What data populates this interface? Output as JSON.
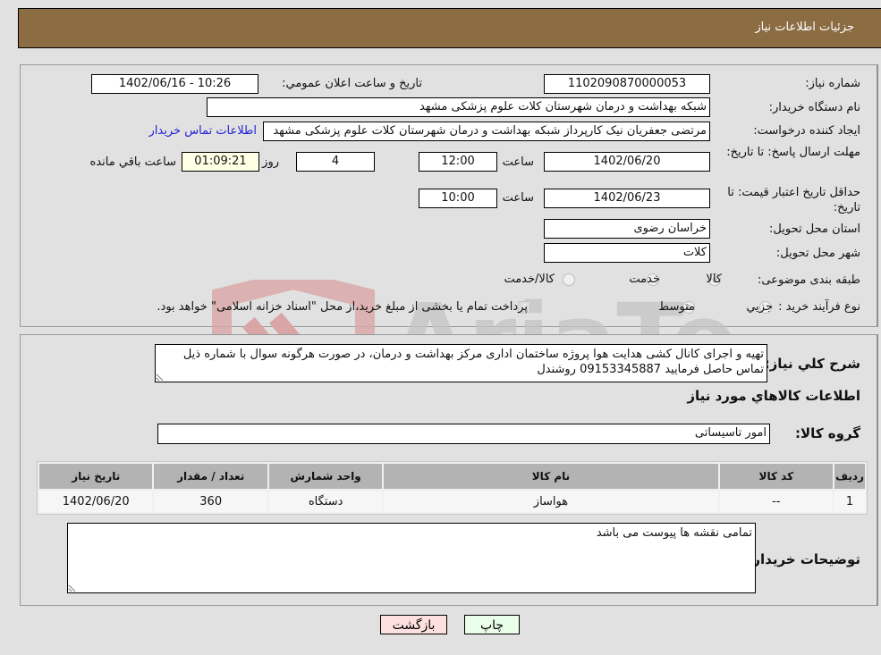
{
  "header": {
    "title": "جزئیات اطلاعات نیاز"
  },
  "form": {
    "need_number": {
      "label": "شماره نیاز:",
      "value": "1102090870000053"
    },
    "announce_datetime": {
      "label": "تاریخ و ساعت اعلان عمومي:",
      "value": "1402/06/16 - 10:26"
    },
    "buyer_org": {
      "label": "نام دستگاه خريدار:",
      "value": "شبکه بهداشت و درمان شهرستان کلات   علوم پزشکی مشهد"
    },
    "requester": {
      "label": "ایجاد کننده درخواست:",
      "value": "مرتضی جعفریان نیک کارپرداز شبکه بهداشت و درمان شهرستان کلات   علوم پزشکی مشهد",
      "contact_link": "اطلاعات تماس خريدار"
    },
    "response_deadline": {
      "label": "مهلت ارسال پاسخ: تا تاریخ:",
      "date": "1402/06/20",
      "time_label": "ساعت",
      "time": "12:00",
      "days": "4",
      "days_label": "روز و",
      "remaining": "01:09:21",
      "remaining_label": "ساعت باقي مانده"
    },
    "price_validity": {
      "label": "حداقل تاريخ اعتبار قيمت: تا تاریخ:",
      "date": "1402/06/23",
      "time_label": "ساعت",
      "time": "10:00"
    },
    "province": {
      "label": "استان محل تحویل:",
      "value": "خراسان رضوی"
    },
    "city": {
      "label": "شهر محل تحویل:",
      "value": "کلات"
    },
    "category": {
      "label": "طبقه بندی موضوعی:",
      "options": [
        "کالا",
        "خدمت",
        "کالا/خدمت"
      ],
      "selected": "کالا"
    },
    "process": {
      "label": "نوع فرآیند خرید :",
      "options": [
        "جزيي",
        "متوسط"
      ],
      "selected": "متوسط",
      "treasury_note": "پرداخت تمام یا بخشی از مبلغ خرید،از محل \"اسناد خزانه اسلامی\" خواهد بود.",
      "treasury_checked": true
    }
  },
  "details": {
    "description_label": "شرح کلي نياز:",
    "description": "تهیه و اجرای کانال کشی هدایت هوا پروژه ساختمان اداری مرکز بهداشت و درمان، در صورت هرگونه سوال با شماره ذیل تماس حاصل فرمایید 09153345887 روشندل",
    "items_title": "اطلاعات کالاهاي مورد نياز",
    "group_label": "گروه کالا:",
    "group_value": "امور تاسیساتی",
    "table": {
      "headers": [
        "رديف",
        "کد کالا",
        "نام کالا",
        "واحد شمارش",
        "تعداد / مقدار",
        "تاريخ نياز"
      ],
      "rows": [
        [
          "1",
          "--",
          "هواساز",
          "دستگاه",
          "360",
          "1402/06/20"
        ]
      ]
    },
    "buyer_notes_label": "توضیحات خریدار:",
    "buyer_notes": "تمامی نقشه ها پیوست می باشد"
  },
  "buttons": {
    "print": "چاپ",
    "back": "بازگشت"
  },
  "colors": {
    "header_bg": "#8c6c43",
    "print_bg": "#eaffea",
    "back_bg": "#ffe0e0",
    "link": "#1f1fd6"
  },
  "watermark": "AriaTender.neT"
}
